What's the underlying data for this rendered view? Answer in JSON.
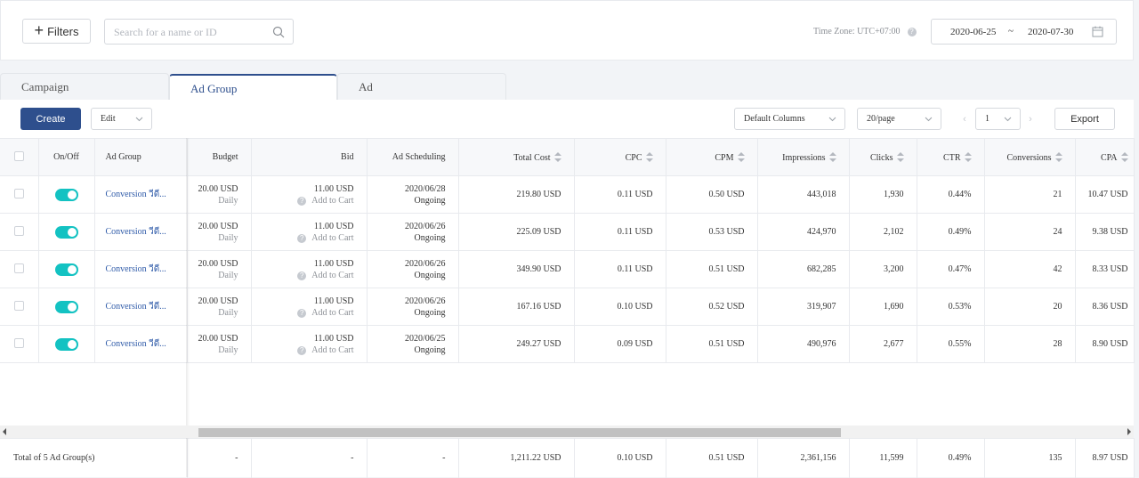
{
  "filters": {
    "label": "Filters"
  },
  "search": {
    "placeholder": "Search for a name or ID"
  },
  "timezone": {
    "label": "Time Zone: UTC+07:00"
  },
  "daterange": {
    "start": "2020-06-25",
    "separator": "~",
    "end": "2020-07-30"
  },
  "tabs": [
    {
      "label": "Campaign",
      "active": false
    },
    {
      "label": "Ad Group",
      "active": true
    },
    {
      "label": "Ad",
      "active": false
    }
  ],
  "toolbar": {
    "create_label": "Create",
    "edit_label": "Edit",
    "columns_label": "Default Columns",
    "page_size_label": "20/page",
    "page_number": "1",
    "export_label": "Export"
  },
  "table": {
    "headers": {
      "onoff": "On/Off",
      "adgroup": "Ad Group",
      "budget": "Budget",
      "bid": "Bid",
      "scheduling": "Ad Scheduling",
      "total_cost": "Total Cost",
      "cpc": "CPC",
      "cpm": "CPM",
      "impressions": "Impressions",
      "clicks": "Clicks",
      "ctr": "CTR",
      "conversions": "Conversions",
      "cpa": "CPA"
    },
    "rows": [
      {
        "name": "Conversion วีดี...",
        "budget": "20.00 USD",
        "budget_type": "Daily",
        "bid": "11.00 USD",
        "bid_event": "Add to Cart",
        "sched_date": "2020/06/28",
        "sched_status": "Ongoing",
        "total_cost": "219.80 USD",
        "cpc": "0.11 USD",
        "cpm": "0.50 USD",
        "impressions": "443,018",
        "clicks": "1,930",
        "ctr": "0.44%",
        "conversions": "21",
        "cpa": "10.47 USD"
      },
      {
        "name": "Conversion วีดี...",
        "budget": "20.00 USD",
        "budget_type": "Daily",
        "bid": "11.00 USD",
        "bid_event": "Add to Cart",
        "sched_date": "2020/06/26",
        "sched_status": "Ongoing",
        "total_cost": "225.09 USD",
        "cpc": "0.11 USD",
        "cpm": "0.53 USD",
        "impressions": "424,970",
        "clicks": "2,102",
        "ctr": "0.49%",
        "conversions": "24",
        "cpa": "9.38 USD"
      },
      {
        "name": "Conversion วีดี...",
        "budget": "20.00 USD",
        "budget_type": "Daily",
        "bid": "11.00 USD",
        "bid_event": "Add to Cart",
        "sched_date": "2020/06/26",
        "sched_status": "Ongoing",
        "total_cost": "349.90 USD",
        "cpc": "0.11 USD",
        "cpm": "0.51 USD",
        "impressions": "682,285",
        "clicks": "3,200",
        "ctr": "0.47%",
        "conversions": "42",
        "cpa": "8.33 USD"
      },
      {
        "name": "Conversion วีดี...",
        "budget": "20.00 USD",
        "budget_type": "Daily",
        "bid": "11.00 USD",
        "bid_event": "Add to Cart",
        "sched_date": "2020/06/26",
        "sched_status": "Ongoing",
        "total_cost": "167.16 USD",
        "cpc": "0.10 USD",
        "cpm": "0.52 USD",
        "impressions": "319,907",
        "clicks": "1,690",
        "ctr": "0.53%",
        "conversions": "20",
        "cpa": "8.36 USD"
      },
      {
        "name": "Conversion วีดี...",
        "budget": "20.00 USD",
        "budget_type": "Daily",
        "bid": "11.00 USD",
        "bid_event": "Add to Cart",
        "sched_date": "2020/06/25",
        "sched_status": "Ongoing",
        "total_cost": "249.27 USD",
        "cpc": "0.09 USD",
        "cpm": "0.51 USD",
        "impressions": "490,976",
        "clicks": "2,677",
        "ctr": "0.55%",
        "conversions": "28",
        "cpa": "8.90 USD"
      }
    ],
    "totals": {
      "label": "Total of 5 Ad Group(s)",
      "budget": "-",
      "bid": "-",
      "scheduling": "-",
      "total_cost": "1,211.22 USD",
      "cpc": "0.10 USD",
      "cpm": "0.51 USD",
      "impressions": "2,361,156",
      "clicks": "11,599",
      "ctr": "0.49%",
      "conversions": "135",
      "cpa": "8.97 USD"
    }
  }
}
